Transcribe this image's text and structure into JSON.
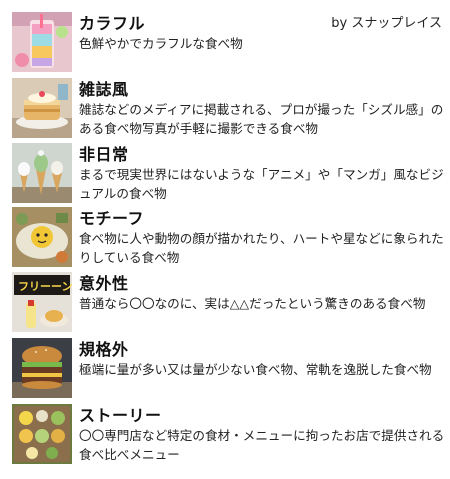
{
  "credit": "by スナップレイス",
  "items": [
    {
      "title": "カラフル",
      "desc": "色鮮やかでカラフルな食べ物"
    },
    {
      "title": "雑誌風",
      "desc": "雑誌などのメディアに掲載される、プロが撮った「シズル感」のある食べ物写真が手軽に撮影できる食べ物"
    },
    {
      "title": "非日常",
      "desc": "まるで現実世界にはないような「アニメ」や「マンガ」風なビジュアルの食べ物"
    },
    {
      "title": "モチーフ",
      "desc": "食べ物に人や動物の顔が描かれたり、ハートや星などに象られたりしている食べ物"
    },
    {
      "title": "意外性",
      "desc": "普通なら〇〇なのに、実は△△だったという驚きのある食べ物"
    },
    {
      "title": "規格外",
      "desc": "極端に量が多い又は量が少ない食べ物、常軌を逸脱した食べ物"
    },
    {
      "title": "ストーリー",
      "desc": "〇〇専門店など特定の食材・メニューに拘ったお店で提供される食べ比べメニュー"
    }
  ],
  "thumbs": [
    {
      "icon": "colorful-drink-photo"
    },
    {
      "icon": "magazine-pancake-photo"
    },
    {
      "icon": "softserve-cones-photo"
    },
    {
      "icon": "character-dessert-photo"
    },
    {
      "icon": "surprise-dessert-photo"
    },
    {
      "icon": "giant-burger-photo"
    },
    {
      "icon": "tasting-set-photo"
    }
  ]
}
